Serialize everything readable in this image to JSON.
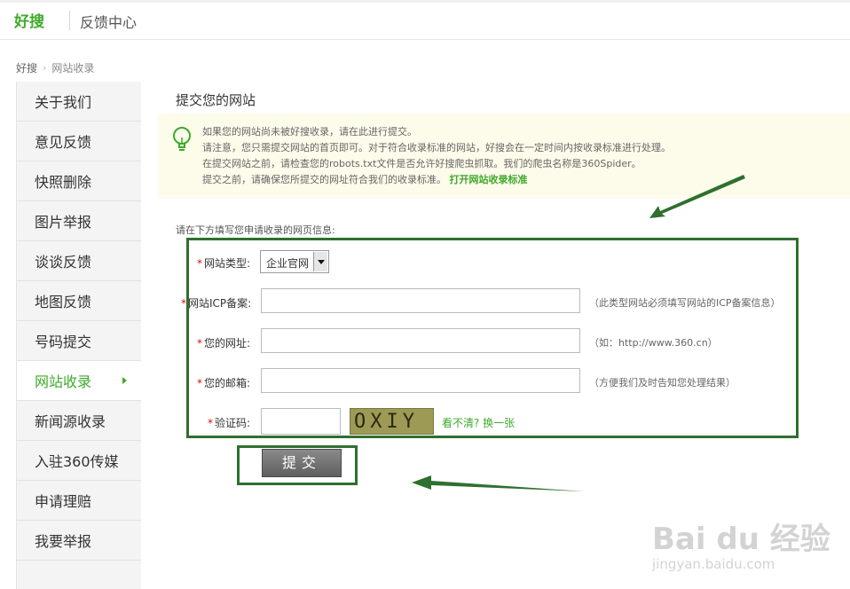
{
  "header": {
    "logo_text": "好搜",
    "title": "反馈中心"
  },
  "breadcrumb": {
    "home": "好搜",
    "current": "网站收录"
  },
  "sidebar": {
    "items": [
      {
        "label": "关于我们"
      },
      {
        "label": "意见反馈"
      },
      {
        "label": "快照删除"
      },
      {
        "label": "图片举报"
      },
      {
        "label": "谈谈反馈"
      },
      {
        "label": "地图反馈"
      },
      {
        "label": "号码提交"
      },
      {
        "label": "网站收录",
        "active": true
      },
      {
        "label": "新闻源收录"
      },
      {
        "label": "入驻360传媒"
      },
      {
        "label": "申请理赔"
      },
      {
        "label": "我要举报"
      }
    ]
  },
  "main": {
    "title": "提交您的网站",
    "tip": {
      "line1": "如果您的网站尚未被好搜收录，请在此进行提交。",
      "line2": "请注意，您只需提交网站的首页即可。对于符合收录标准的网站，好搜会在一定时间内按收录标准进行处理。",
      "line3": "在提交网站之前，请检查您的robots.txt文件是否允许好搜爬虫抓取。我们的爬虫名称是360Spider。",
      "line4": "提交之前，请确保您所提交的网址符合我们的收录标准。",
      "link": "打开网站收录标准"
    },
    "form_intro": "请在下方填写您申请收录的网页信息:",
    "form": {
      "required_mark": "*",
      "site_type_label": "网站类型:",
      "site_type_value": "企业官网",
      "icp_label": "网站ICP备案:",
      "icp_value": "",
      "icp_hint": "（此类型网站必须填写网站的ICP备案信息）",
      "url_label": "您的网址:",
      "url_value": "",
      "url_hint": "（如：http://www.360.cn）",
      "email_label": "您的邮箱:",
      "email_value": "",
      "email_hint": "（方便我们及时告知您处理结果）",
      "captcha_label": "验证码:",
      "captcha_value": "",
      "captcha_image_text": "OXIY",
      "captcha_refresh": "看不清? 换一张",
      "submit_label": "提交"
    }
  },
  "watermark": {
    "main": "Bai du 经验",
    "sub": "jingyan.baidu.com"
  },
  "colors": {
    "brand_green": "#3eaa2b",
    "annotation_green": "#2f6f2f",
    "required_red": "#d01010",
    "tip_bg": "#fdfbea"
  }
}
